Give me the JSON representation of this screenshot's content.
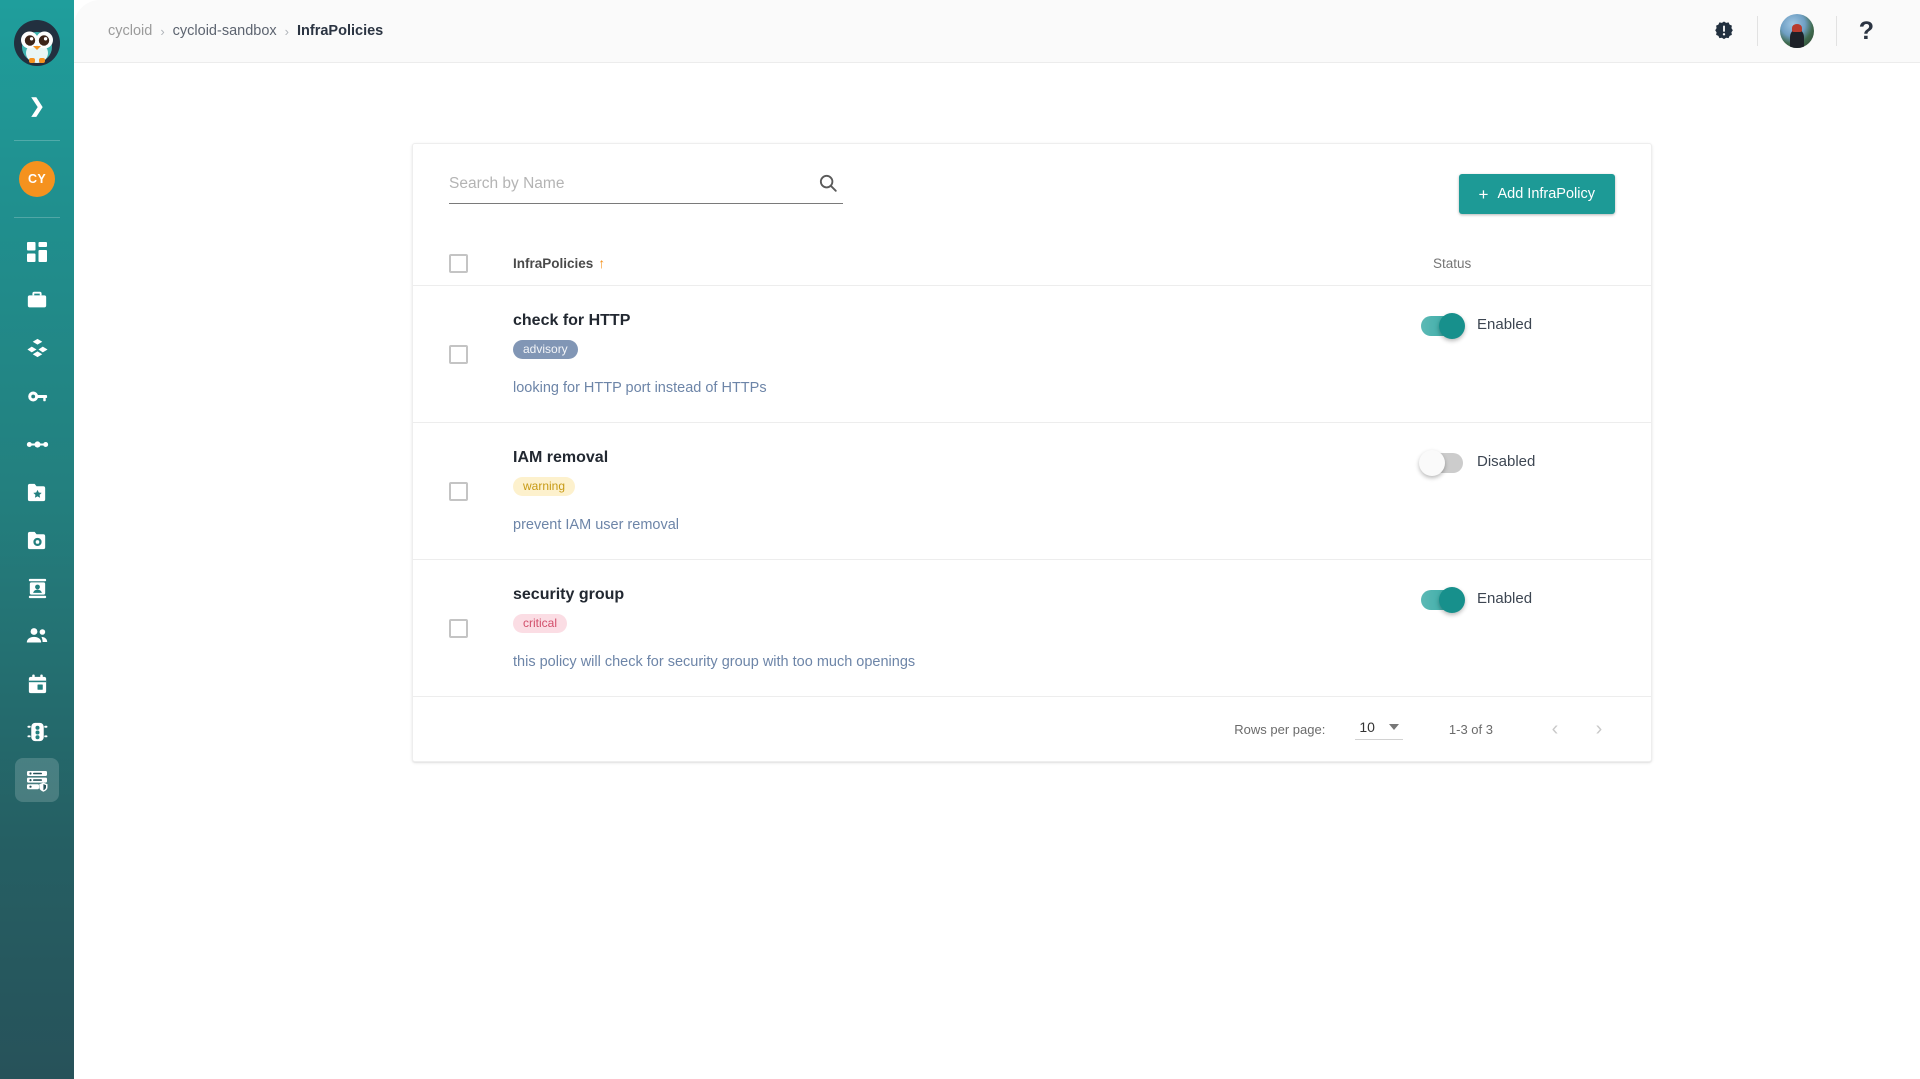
{
  "sidebar": {
    "logo_icon": "cycloid-owl-logo",
    "expand_icon": "chevron-right-icon",
    "org_badge": "CY",
    "items": [
      {
        "icon": "dashboard-icon",
        "name": "sidebar-item-dashboard",
        "active": false
      },
      {
        "icon": "briefcase-icon",
        "name": "sidebar-item-projects",
        "active": false
      },
      {
        "icon": "stacks-icon",
        "name": "sidebar-item-stacks",
        "active": false
      },
      {
        "icon": "key-icon",
        "name": "sidebar-item-credentials",
        "active": false
      },
      {
        "icon": "pipeline-icon",
        "name": "sidebar-item-pipelines",
        "active": false
      },
      {
        "icon": "folder-star-icon",
        "name": "sidebar-item-catalog",
        "active": false
      },
      {
        "icon": "folder-gear-icon",
        "name": "sidebar-item-config-repository",
        "active": false
      },
      {
        "icon": "id-card-icon",
        "name": "sidebar-item-service-catalog",
        "active": false
      },
      {
        "icon": "users-icon",
        "name": "sidebar-item-members",
        "active": false
      },
      {
        "icon": "calendar-icon",
        "name": "sidebar-item-events",
        "active": false
      },
      {
        "icon": "traffic-light-icon",
        "name": "sidebar-item-quotas",
        "active": false
      },
      {
        "icon": "infrapolicy-icon",
        "name": "sidebar-item-infrapolicies",
        "active": true
      }
    ]
  },
  "topbar": {
    "breadcrumb": {
      "org": "cycloid",
      "project": "cycloid-sandbox",
      "current": "InfraPolicies",
      "separator": "›"
    },
    "alert_icon": "alert-badge-icon",
    "avatar_icon": "user-avatar",
    "help_icon": "question-mark-icon",
    "help_glyph": "?"
  },
  "search": {
    "placeholder": "Search by Name",
    "value": "",
    "icon": "search-icon"
  },
  "add_button": {
    "label": "Add InfraPolicy",
    "plus": "+",
    "color": "#1d9a96"
  },
  "table": {
    "header": {
      "name_column": "InfraPolicies",
      "sort_arrow": "↑",
      "status_column": "Status",
      "select_all_icon": "checkbox-unchecked-icon"
    },
    "rows": [
      {
        "name": "check for HTTP",
        "severity": "advisory",
        "severity_class": "advisory",
        "description": "looking for HTTP port instead of HTTPs",
        "status_label": "Enabled",
        "enabled": true
      },
      {
        "name": "IAM removal",
        "severity": "warning",
        "severity_class": "warning",
        "description": "prevent IAM user removal",
        "status_label": "Disabled",
        "enabled": false
      },
      {
        "name": "security group",
        "severity": "critical",
        "severity_class": "critical",
        "description": "this policy will check for security group with too much openings",
        "status_label": "Enabled",
        "enabled": true
      }
    ]
  },
  "pagination": {
    "rows_per_page_label": "Rows per page:",
    "rows_per_page_value": "10",
    "range": "1-3 of 3",
    "prev_icon": "chevron-left-icon",
    "next_icon": "chevron-right-icon",
    "prev_glyph": "‹",
    "next_glyph": "›"
  }
}
